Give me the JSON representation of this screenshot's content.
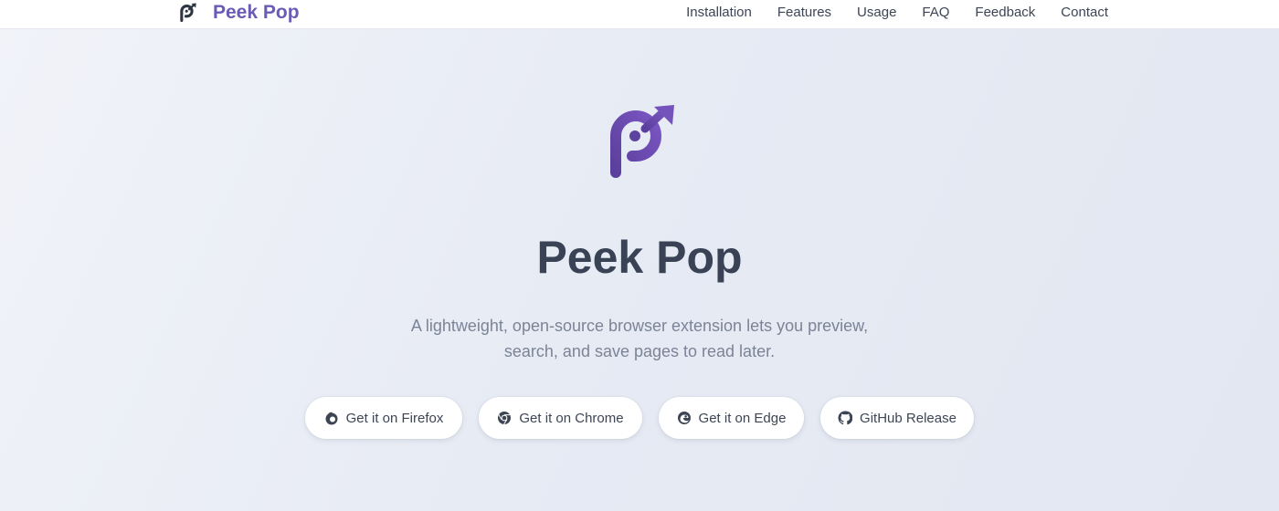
{
  "header": {
    "brand_name": "Peek Pop",
    "nav": [
      {
        "label": "Installation"
      },
      {
        "label": "Features"
      },
      {
        "label": "Usage"
      },
      {
        "label": "FAQ"
      },
      {
        "label": "Feedback"
      },
      {
        "label": "Contact"
      }
    ]
  },
  "hero": {
    "logo_icon": "peek-pop-logo-icon",
    "title": "Peek Pop",
    "description_line1": "A lightweight, open-source browser extension lets you preview,",
    "description_line2": "search, and save pages to read later.",
    "buttons": [
      {
        "label": "Get it on Firefox",
        "icon": "firefox-icon"
      },
      {
        "label": "Get it on Chrome",
        "icon": "chrome-icon"
      },
      {
        "label": "Get it on Edge",
        "icon": "edge-icon"
      },
      {
        "label": "GitHub Release",
        "icon": "github-icon"
      }
    ]
  },
  "colors": {
    "brand": "#6b5bb5",
    "logo_gradient_start": "#5b3f9c",
    "logo_gradient_end": "#7a56c2",
    "text_dark": "#3a4356",
    "text_muted": "#7b8496"
  }
}
